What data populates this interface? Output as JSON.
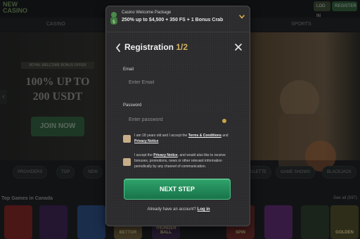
{
  "site": {
    "logo_text": "NEW CASINO",
    "login_label": "LOG IN",
    "register_label": "REGISTER",
    "nav": [
      "CASINO",
      "SPORTS"
    ],
    "hero": {
      "tag": "ROYAL WELCOME BONUS OFFER",
      "title": "100% UP TO 200 USDT",
      "join_label": "JOIN NOW"
    },
    "filters": [
      "PROVIDERS",
      "TOP",
      "NEW",
      "ROULETTE",
      "GAME SHOWS",
      "BLACKJACK"
    ],
    "games_title": "Top Games in Canada",
    "games_see_all": "See all (597)",
    "tiles": [
      "BETTOR",
      "THUNDER BALL",
      "SPIN",
      "GOLDEN"
    ]
  },
  "modal": {
    "promo": {
      "title": "Casino Welcome Package",
      "offer": "250% up to $4,500 + 350 FS + 1 Bonus Crab"
    },
    "header": {
      "title": "Registration",
      "step": "1/2"
    },
    "email": {
      "label": "Email",
      "placeholder": "Enter Email"
    },
    "password": {
      "label": "Password",
      "placeholder": "Enter password"
    },
    "terms": {
      "text_before": "I am 18 years old and I accept the ",
      "terms_link": "Terms & Conditions",
      "text_middle": " and ",
      "privacy_link": "Privacy Notice"
    },
    "marketing": {
      "text_before": "I accept the ",
      "privacy_link": "Privacy Notice",
      "text_after": ", and would also like to receive bonuses, promotions, news or other relevant information periodically by any channel of communication."
    },
    "next_label": "NEXT STEP",
    "account": {
      "text": "Already have an account?",
      "login_link": "Log in"
    }
  },
  "colors": {
    "accent_gold": "#d2b160",
    "primary_green": "#1f8a57",
    "modal_bg": "#2b2b2d"
  }
}
